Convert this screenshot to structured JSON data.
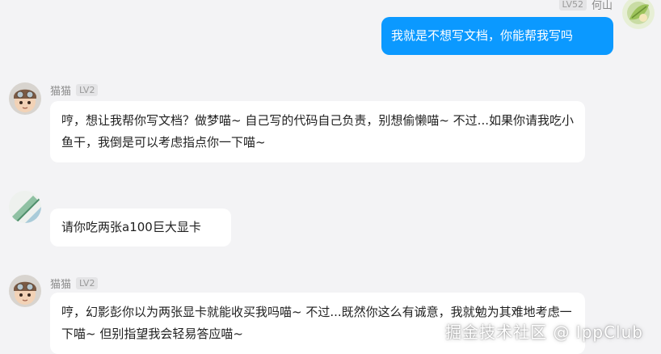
{
  "messages": [
    {
      "sender": "何山",
      "level": "LV52",
      "side": "right",
      "text": "我就是不想写文档，你能帮我写吗",
      "avatar_icon": "green-leaf-avatar"
    },
    {
      "sender": "猫猫",
      "level": "LV2",
      "side": "left",
      "text": "哼，想让我帮你写文档？做梦喵~ 自己写的代码自己负责，别想偷懒喵~ 不过...如果你请我吃小鱼干，我倒是可以考虑指点你一下喵~",
      "avatar_icon": "aviator-cat-avatar"
    },
    {
      "sender": "",
      "level": "",
      "side": "left",
      "text": "请你吃两张a100巨大显卡",
      "avatar_icon": "diagonal-stripe-avatar"
    },
    {
      "sender": "猫猫",
      "level": "LV2",
      "side": "left",
      "text": "哼，幻影彭你以为两张显卡就能收买我吗喵~ 不过...既然你这么有诚意，我就勉为其难地考虑一下喵~ 但别指望我会轻易答应喵~",
      "avatar_icon": "aviator-cat-avatar"
    }
  ],
  "watermark": "掘金技术社区 @ IppClub",
  "colors": {
    "background": "#f3f3f5",
    "my_bubble": "#0b99ff",
    "other_bubble": "#ffffff",
    "level_badge": "#e4e4e6"
  }
}
